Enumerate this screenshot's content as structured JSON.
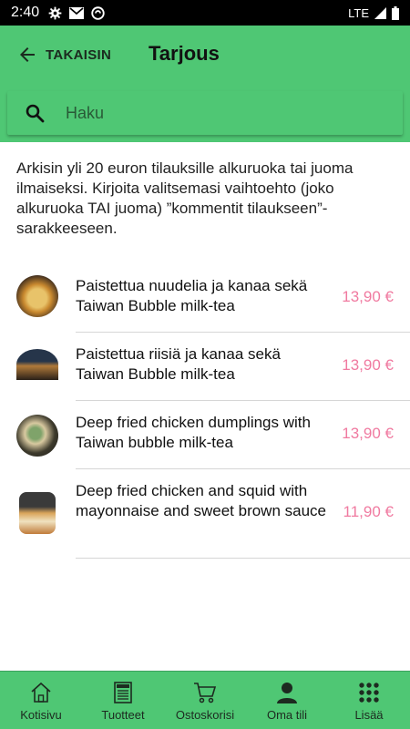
{
  "status_bar": {
    "time": "2:40",
    "network": "LTE"
  },
  "header": {
    "back_label": "TAKAISIN",
    "title": "Tarjous"
  },
  "search": {
    "placeholder": "Haku"
  },
  "intro_text": "Arkisin yli 20 euron tilauksille alkuruoka tai juoma ilmaiseksi. Kirjoita valitsemasi vaihtoehto (joko alkuruoka TAI juoma) ”kommentit tilaukseen”-sarakkeeseen.",
  "products": [
    {
      "name": "Paistettua nuudelia ja kanaa sekä Taiwan Bubble milk-tea",
      "price": "13,90 €"
    },
    {
      "name": "Paistettua riisiä ja kanaa sekä Taiwan Bubble milk-tea",
      "price": "13,90 €"
    },
    {
      "name": "Deep fried chicken dumplings with Taiwan bubble milk-tea",
      "price": "13,90 €"
    },
    {
      "name": "Deep fried chicken and squid with mayonnaise and sweet brown sauce",
      "price": "11,90 €"
    }
  ],
  "nav": [
    {
      "label": "Kotisivu",
      "icon": "home-icon"
    },
    {
      "label": "Tuotteet",
      "icon": "menu-icon"
    },
    {
      "label": "Ostoskorisi",
      "icon": "cart-icon"
    },
    {
      "label": "Oma tili",
      "icon": "person-icon"
    },
    {
      "label": "Lisää",
      "icon": "grid-icon"
    }
  ],
  "colors": {
    "primary": "#4fc774",
    "price": "#f07aa0",
    "status_bar": "#000000"
  }
}
